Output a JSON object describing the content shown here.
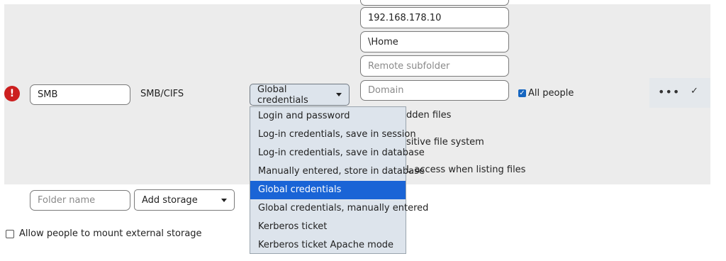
{
  "mount": {
    "name_value": "SMB",
    "type_label": "SMB/CIFS",
    "auth_selected": "Global credentials",
    "host_value": "192.168.178.10",
    "share_value": "\\Home",
    "subfolder_placeholder": "Remote subfolder",
    "domain_placeholder": "Domain",
    "applicable_label": "All people",
    "option_hidden": "dden files",
    "option_case": "sitive file system",
    "option_acl": "L access when listing files"
  },
  "auth_options": [
    {
      "label": "Login and password",
      "selected": false
    },
    {
      "label": "Log-in credentials, save in session",
      "selected": false
    },
    {
      "label": "Log-in credentials, save in database",
      "selected": false
    },
    {
      "label": "Manually entered, store in database",
      "selected": false
    },
    {
      "label": "Global credentials",
      "selected": true
    },
    {
      "label": "Global credentials, manually entered",
      "selected": false
    },
    {
      "label": "Kerberos ticket",
      "selected": false
    },
    {
      "label": "Kerberos ticket Apache mode",
      "selected": false
    }
  ],
  "new_row": {
    "folder_placeholder": "Folder name",
    "add_storage_label": "Add storage"
  },
  "allow_mount_label": "Allow people to mount external storage",
  "icons": {
    "error": "exclamation-icon",
    "more": "more-dots-icon",
    "save": "checkmark-icon"
  },
  "colors": {
    "error": "#cc1f1f",
    "selected": "#1a64d6",
    "dropdown_bg": "#dde4ec"
  }
}
